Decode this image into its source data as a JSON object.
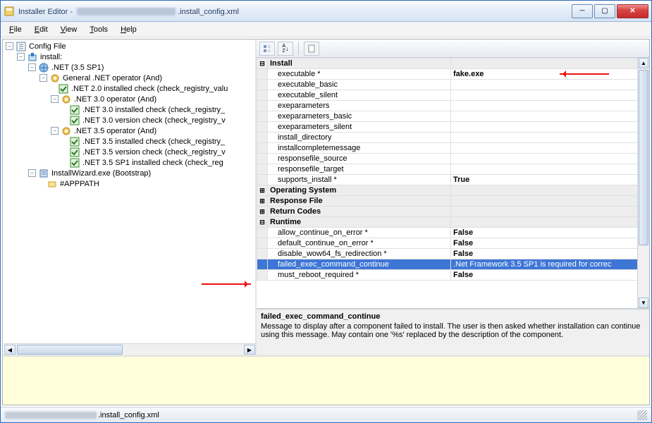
{
  "window": {
    "title_prefix": "Installer Editor - ",
    "title_suffix": ".install_config.xml"
  },
  "menu": {
    "file": "File",
    "edit": "Edit",
    "view": "View",
    "tools": "Tools",
    "help": "Help"
  },
  "tree": {
    "root": "Config File",
    "install": "install:",
    "net": ".NET (3.5 SP1)",
    "gen": "General .NET operator (And)",
    "n20": ".NET 2.0 installed check (check_registry_valu",
    "n30op": ".NET 3.0 operator (And)",
    "n30i": ".NET 3.0 installed check (check_registry_",
    "n30v": ".NET 3.0 version check (check_registry_v",
    "n35op": ".NET 3.5 operator (And)",
    "n35i": ".NET 3.5 installed check (check_registry_",
    "n35v": ".NET 3.5 version check (check_registry_v",
    "n35sp": ".NET 3.5 SP1 installed check (check_reg",
    "wiz": "InstallWizard.exe (Bootstrap)",
    "app": "#APPPATH"
  },
  "grid": {
    "cat_install": "Install",
    "rows_install": [
      {
        "k": "executable *",
        "v": "fake.exe"
      },
      {
        "k": "executable_basic",
        "v": ""
      },
      {
        "k": "executable_silent",
        "v": ""
      },
      {
        "k": "exeparameters",
        "v": ""
      },
      {
        "k": "exeparameters_basic",
        "v": ""
      },
      {
        "k": "exeparameters_silent",
        "v": ""
      },
      {
        "k": "install_directory",
        "v": ""
      },
      {
        "k": "installcompletemessage",
        "v": ""
      },
      {
        "k": "responsefile_source",
        "v": ""
      },
      {
        "k": "responsefile_target",
        "v": ""
      },
      {
        "k": "supports_install *",
        "v": "True"
      }
    ],
    "cat_os": "Operating System",
    "cat_resp": "Response File",
    "cat_ret": "Return Codes",
    "cat_rt": "Runtime",
    "rows_rt": [
      {
        "k": "allow_continue_on_error *",
        "v": "False"
      },
      {
        "k": "default_continue_on_error *",
        "v": "False"
      },
      {
        "k": "disable_wow64_fs_redirection *",
        "v": "False"
      },
      {
        "k": "failed_exec_command_continue",
        "v": ".Net Framework 3.5 SP1 is required for correc",
        "sel": true
      },
      {
        "k": "must_reboot_required *",
        "v": "False"
      }
    ]
  },
  "desc": {
    "title": "failed_exec_command_continue",
    "body": "Message to display after a component failed to install. The user is then asked whether installation can continue using this message. May contain one '%s' replaced by the description of the component."
  },
  "status": {
    "suffix": ".install_config.xml"
  }
}
